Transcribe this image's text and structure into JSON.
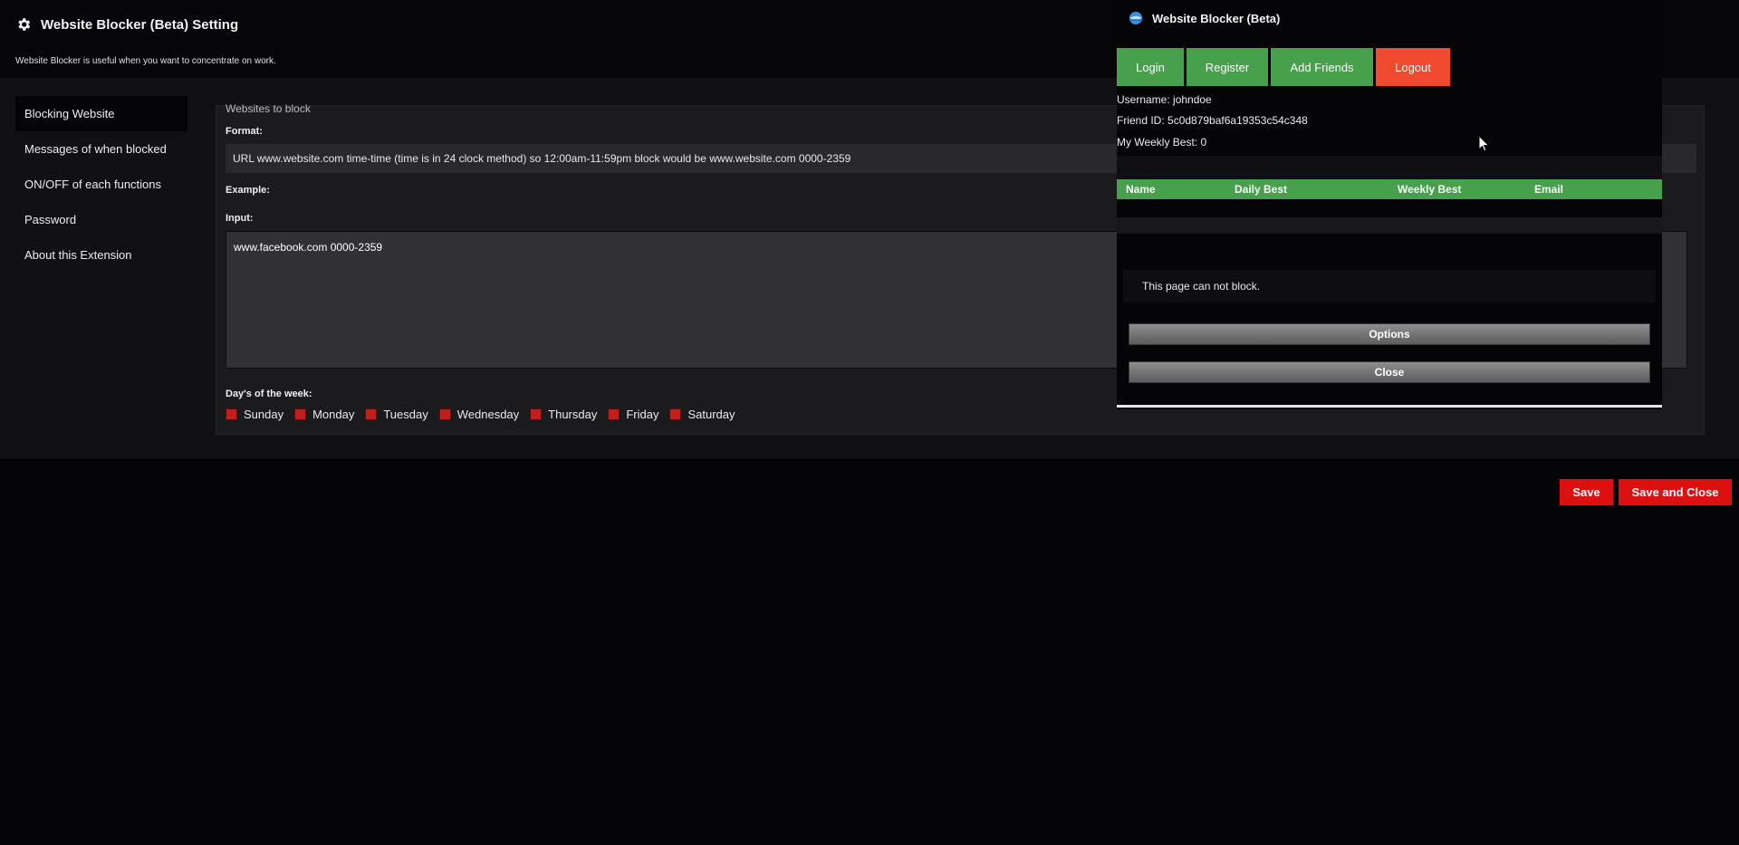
{
  "header": {
    "title": "Website Blocker (Beta) Setting",
    "subtitle": "Website Blocker is useful when you want to concentrate on work."
  },
  "sidebar": {
    "items": [
      {
        "label": "Blocking Website",
        "active": true
      },
      {
        "label": "Messages of when blocked",
        "active": false
      },
      {
        "label": "ON/OFF of each functions",
        "active": false
      },
      {
        "label": "Password",
        "active": false
      },
      {
        "label": "About this Extension",
        "active": false
      }
    ]
  },
  "main": {
    "section_title": "Websites to block",
    "format_label": "Format:",
    "format_text": "URL www.website.com time-time (time is in 24 clock method) so 12:00am-11:59pm block would be www.website.com 0000-2359",
    "example_label": "Example:",
    "input_label": "Input:",
    "input_value": "www.facebook.com 0000-2359",
    "days_label": "Day's of the week:",
    "days": [
      "Sunday",
      "Monday",
      "Tuesday",
      "Wednesday",
      "Thursday",
      "Friday",
      "Saturday"
    ]
  },
  "footer": {
    "save_label": "Save",
    "save_close_label": "Save and Close"
  },
  "popup": {
    "title": "Website Blocker (Beta)",
    "buttons": {
      "login": "Login",
      "register": "Register",
      "add_friends": "Add Friends",
      "logout": "Logout"
    },
    "username_line": "Username: johndoe",
    "friend_id_line": "Friend ID: 5c0d879baf6a19353c54c348",
    "weekly_best_line": "My Weekly Best: 0",
    "table_headers": {
      "name": "Name",
      "daily_best": "Daily Best",
      "weekly_best": "Weekly Best",
      "email": "Email"
    },
    "status_message": "This page can not block.",
    "options_label": "Options",
    "close_label": "Close"
  },
  "colors": {
    "accent_red": "#dc1010",
    "green": "#46a04c",
    "logout_orange": "#f04b2f",
    "checkbox_red": "#c21e1e"
  },
  "icons": {
    "header": "gear-icon",
    "popup": "globe-icon",
    "pointer": "cursor-icon"
  }
}
